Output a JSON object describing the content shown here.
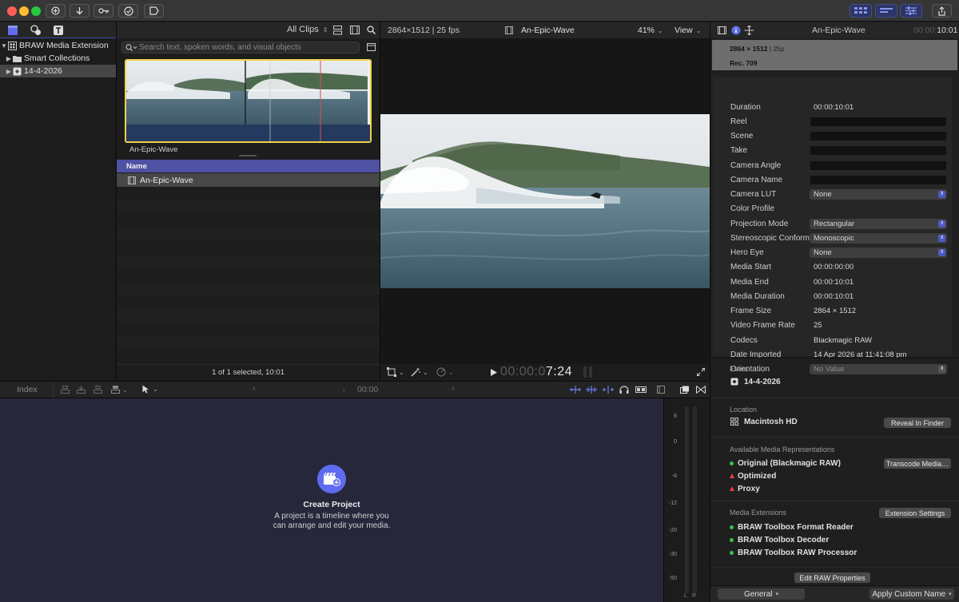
{
  "toolbar": {
    "colors": {
      "close": "#ff5f57",
      "minimize": "#febc2e",
      "zoom": "#28c840",
      "accent": "#4c59c4"
    }
  },
  "library": {
    "items": [
      {
        "label": "BRAW Media Extension",
        "icon": "library-icon"
      },
      {
        "label": "Smart Collections",
        "icon": "folder-icon"
      },
      {
        "label": "14-4-2026",
        "icon": "event-icon"
      }
    ]
  },
  "browser": {
    "filter": "All Clips",
    "search_placeholder": "Search text, spoken words, and visual objects",
    "clip_name": "An-Epic-Wave",
    "column_name": "Name",
    "rows": [
      {
        "name": "An-Epic-Wave"
      }
    ],
    "status": "1 of 1 selected, 10:01"
  },
  "viewer": {
    "format": "2864×1512 | 25 fps",
    "clip_title": "An-Epic-Wave",
    "zoom": "41%",
    "view": "View",
    "timecode_dim": "00:00:0",
    "timecode_bright": "7:24"
  },
  "inspector": {
    "title": "An-Epic-Wave",
    "duration_dim": "00:00:",
    "duration": "10:01",
    "header_line1": "2864 × 1512",
    "header_line1b": "25p",
    "header_line2": "Rec. 709",
    "rows": [
      {
        "key": "Duration",
        "value": "00:00:10:01",
        "kind": "text"
      },
      {
        "key": "Reel",
        "value": "",
        "kind": "box"
      },
      {
        "key": "Scene",
        "value": "",
        "kind": "box"
      },
      {
        "key": "Take",
        "value": "",
        "kind": "box"
      },
      {
        "key": "Camera Angle",
        "value": "",
        "kind": "box"
      },
      {
        "key": "Camera Name",
        "value": "",
        "kind": "box"
      },
      {
        "key": "Camera LUT",
        "value": "None",
        "kind": "popup"
      },
      {
        "key": "Color Profile",
        "value": "",
        "kind": "text"
      },
      {
        "key": "Projection Mode",
        "value": "Rectangular",
        "kind": "popup"
      },
      {
        "key": "Stereoscopic Conform",
        "value": "Monoscopic",
        "kind": "popup"
      },
      {
        "key": "Hero Eye",
        "value": "None",
        "kind": "popup"
      },
      {
        "key": "Media Start",
        "value": "00:00:00:00",
        "kind": "text"
      },
      {
        "key": "Media End",
        "value": "00:00:10:01",
        "kind": "text"
      },
      {
        "key": "Media Duration",
        "value": "00:00:10:01",
        "kind": "text"
      },
      {
        "key": "Frame Size",
        "value": "2864 × 1512",
        "kind": "text"
      },
      {
        "key": "Video Frame Rate",
        "value": "25",
        "kind": "text"
      },
      {
        "key": "Codecs",
        "value": "Blackmagic RAW",
        "kind": "text"
      },
      {
        "key": "Date Imported",
        "value": "14 Apr 2026 at 11:41:08 pm",
        "kind": "text"
      },
      {
        "key": "Orientation",
        "value": "No Value",
        "kind": "popup-dim"
      }
    ],
    "event_label": "Event",
    "event_value": "14-4-2026",
    "location_label": "Location",
    "location_value": "Macintosh HD",
    "reveal_button": "Reveal In Finder",
    "reps_label": "Available Media Representations",
    "reps": [
      {
        "label": "Original (Blackmagic RAW)",
        "status": "available"
      },
      {
        "label": "Optimized",
        "status": "missing"
      },
      {
        "label": "Proxy",
        "status": "missing"
      }
    ],
    "transcode_button": "Transcode Media…",
    "ext_label": "Media Extensions",
    "ext_button": "Extension Settings",
    "extensions": [
      {
        "label": "BRAW Toolbox Format Reader"
      },
      {
        "label": "BRAW Toolbox Decoder"
      },
      {
        "label": "BRAW Toolbox RAW Processor"
      }
    ],
    "edit_raw_button": "Edit RAW Properties",
    "metadata_view": "General",
    "apply_button": "Apply Custom Name"
  },
  "timeline": {
    "index": "Index",
    "timecode": "00:00",
    "empty_title": "Create Project",
    "empty_desc_line1": "A project is a timeline where you",
    "empty_desc_line2": "can arrange and edit your media.",
    "meter_scale": [
      "6",
      "0",
      "-6",
      "-12",
      "-20",
      "-30",
      "-50"
    ],
    "meter_channels": [
      "L",
      "R"
    ]
  }
}
